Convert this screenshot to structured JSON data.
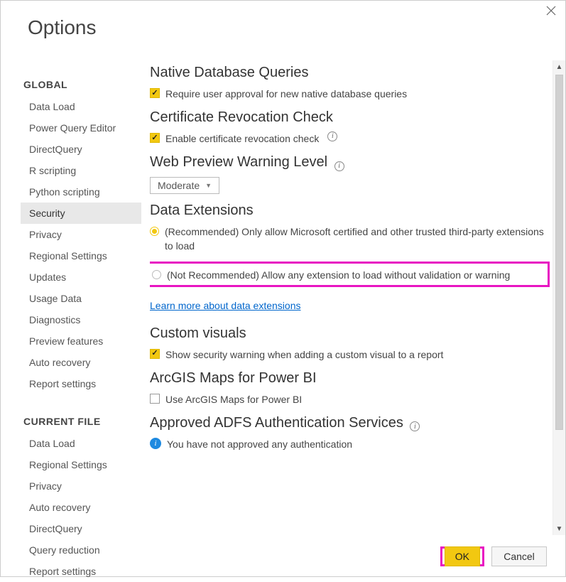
{
  "window": {
    "title": "Options"
  },
  "sidebar": {
    "group1": "GLOBAL",
    "items1": [
      "Data Load",
      "Power Query Editor",
      "DirectQuery",
      "R scripting",
      "Python scripting",
      "Security",
      "Privacy",
      "Regional Settings",
      "Updates",
      "Usage Data",
      "Diagnostics",
      "Preview features",
      "Auto recovery",
      "Report settings"
    ],
    "group2": "CURRENT FILE",
    "items2": [
      "Data Load",
      "Regional Settings",
      "Privacy",
      "Auto recovery",
      "DirectQuery",
      "Query reduction",
      "Report settings"
    ],
    "selected": "Security"
  },
  "sections": {
    "native_db": {
      "title": "Native Database Queries",
      "opt1": "Require user approval for new native database queries"
    },
    "cert": {
      "title": "Certificate Revocation Check",
      "opt1": "Enable certificate revocation check"
    },
    "web": {
      "title": "Web Preview Warning Level",
      "value": "Moderate"
    },
    "data_ext": {
      "title": "Data Extensions",
      "opt1": "(Recommended) Only allow Microsoft certified and other trusted third-party extensions to load",
      "opt2": "(Not Recommended) Allow any extension to load without validation or warning",
      "link": "Learn more about data extensions"
    },
    "visuals": {
      "title": "Custom visuals",
      "opt1": "Show security warning when adding a custom visual to a report"
    },
    "arcgis": {
      "title": "ArcGIS Maps for Power BI",
      "opt1": "Use ArcGIS Maps for Power BI"
    },
    "adfs": {
      "title": "Approved ADFS Authentication Services",
      "msg": "You have not approved any authentication"
    }
  },
  "footer": {
    "ok": "OK",
    "cancel": "Cancel"
  }
}
